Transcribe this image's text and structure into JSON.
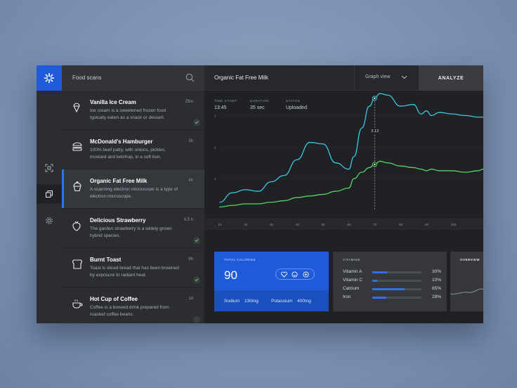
{
  "list": {
    "title": "Food scans",
    "items": [
      {
        "name": "Vanilla Ice Cream",
        "desc": "Ice cream is a sweetened frozen food typically eaten as a snack or dessert.",
        "time": "25m",
        "icon": "ice-cream-icon",
        "checked": true
      },
      {
        "name": "McDonald's Hamburger",
        "desc": "100% beef patty, with onions, pickles, mustard and ketchup, in a soft bun.",
        "time": "3h",
        "icon": "burger-icon",
        "checked": false
      },
      {
        "name": "Organic Fat Free Milk",
        "desc": "A scanning electron microscope is a type of electron microscope.",
        "time": "4h",
        "icon": "cupcake-icon",
        "checked": false
      },
      {
        "name": "Delicious Strawberry",
        "desc": "The garden strawberry is a widely grown hybrid species.",
        "time": "4.5 h",
        "icon": "strawberry-icon",
        "checked": true
      },
      {
        "name": "Burnt Toast",
        "desc": "Toast is sliced bread that has been browned by exposure to radiant heat.",
        "time": "9h",
        "icon": "toast-icon",
        "checked": true
      },
      {
        "name": "Hot Cup of Coffee",
        "desc": "Coffee is a brewed drink prepared from roasted coffee beans.",
        "time": "1d",
        "icon": "coffee-icon",
        "checked": false
      }
    ]
  },
  "main": {
    "title": "Organic Fat Free Milk",
    "graph_view_label": "Graph view",
    "analyze_label": "ANALYZE",
    "meta": {
      "timestamp_label": "TIME STAMP",
      "timestamp": "13:45",
      "duration_label": "DURATION",
      "duration": "35 sec",
      "status_label": "STATUS",
      "status": "Uploaded"
    }
  },
  "cards": {
    "calories": {
      "label": "TOTAL CALORIES",
      "value": "90",
      "sodium_label": "Sodium",
      "sodium": "130mg",
      "potassium_label": "Potassium",
      "potassium": "400mg"
    },
    "vitamins": {
      "label": "VITAMINS",
      "rows": [
        {
          "name": "Vitamin A",
          "pct": "30%",
          "value": 0.3
        },
        {
          "name": "Vitamin C",
          "pct": "10%",
          "value": 0.1
        },
        {
          "name": "Calcium",
          "pct": "65%",
          "value": 0.65
        },
        {
          "name": "Iron",
          "pct": "28%",
          "value": 0.28
        }
      ]
    },
    "overview": {
      "label": "OVERVIEW"
    }
  },
  "colors": {
    "accent": "#1f5bd8",
    "cyan": "#3ec6e0",
    "green": "#56d364"
  },
  "chart_data": {
    "type": "line",
    "x": [
      10,
      15,
      20,
      25,
      30,
      35,
      40,
      45,
      50,
      55,
      60,
      62,
      65,
      68,
      70,
      72,
      75,
      80,
      85,
      88,
      90,
      92,
      95,
      100,
      105,
      110,
      112
    ],
    "x_ticks": [
      "10",
      "20",
      "30",
      "40",
      "50",
      "60",
      "70",
      "80",
      "90",
      "100"
    ],
    "y_ticks": [
      "1",
      "2",
      "3"
    ],
    "ylim": [
      0,
      3.7
    ],
    "xlim": [
      8,
      112
    ],
    "series": [
      {
        "values": [
          0.25,
          0.55,
          0.65,
          0.6,
          0.9,
          1.1,
          1.6,
          2.15,
          2.1,
          1.5,
          1.3,
          1.7,
          2.6,
          3.3,
          3.55,
          3.7,
          3.65,
          3.3,
          3.35,
          3.05,
          3.15,
          3.0,
          3.1,
          3.05,
          3.0,
          2.95,
          2.95
        ]
      },
      {
        "values": [
          0.1,
          0.15,
          0.2,
          0.2,
          0.25,
          0.3,
          0.4,
          0.45,
          0.5,
          0.6,
          0.7,
          1.0,
          1.2,
          1.35,
          1.45,
          1.55,
          1.5,
          1.4,
          1.35,
          1.3,
          1.25,
          1.3,
          1.25,
          1.25,
          1.2,
          1.25,
          1.3
        ]
      }
    ],
    "marker": {
      "x": 70,
      "label": "2.13"
    }
  }
}
